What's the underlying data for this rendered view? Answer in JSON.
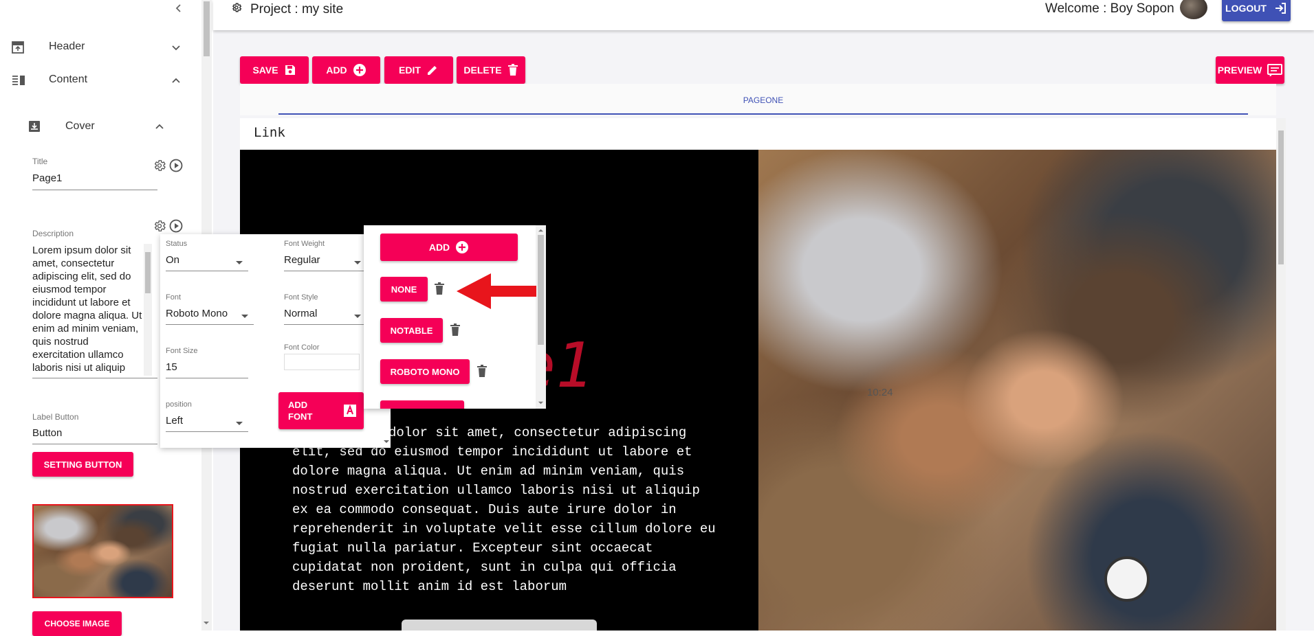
{
  "topbar": {
    "project_title": "Project : my site",
    "welcome": "Welcome : Boy Sopon",
    "logout_label": "LOGOUT"
  },
  "sidebar": {
    "items": [
      {
        "label": "Header",
        "icon": "header-icon"
      },
      {
        "label": "Content",
        "icon": "content-icon"
      }
    ],
    "cover": {
      "label": "Cover",
      "title_label": "Title",
      "title_value": "Page1",
      "description_label": "Description",
      "description_value": "Lorem ipsum dolor sit amet, consectetur adipiscing elit, sed do eiusmod tempor incididunt ut labore et dolore magna aliqua. Ut enim ad minim veniam, quis nostrud exercitation ullamco laboris nisi ut aliquip",
      "label_button_label": "Label Button",
      "label_button_value": "Button",
      "setting_button": "SETTING BUTTON",
      "choose_image": "CHOOSE IMAGE"
    }
  },
  "toolbar": {
    "save": "SAVE",
    "add": "ADD",
    "edit": "EDIT",
    "delete": "DELETE",
    "preview": "PREVIEW"
  },
  "tabs": {
    "active": "PAGEONE"
  },
  "preview": {
    "nav_link": "Link",
    "title_partial": "e1",
    "body": "dolor sit amet, consectetur adipiscing elit, sed do eiusmod tempor incididunt ut labore et dolore magna aliqua. Ut enim ad minim veniam, quis nostrud exercitation ullamco laboris nisi ut aliquip ex ea commodo consequat. Duis aute irure dolor in reprehenderit in voluptate velit esse cillum dolore eu fugiat nulla pariatur. Excepteur sint occaecat cupidatat non proident, sunt in culpa qui officia deserunt mollit anim id est laborum",
    "photo_clock": "10:24"
  },
  "font_panel": {
    "status_label": "Status",
    "status_value": "On",
    "font_weight_label": "Font Weight",
    "font_weight_value": "Regular",
    "font_label": "Font",
    "font_value": "Roboto Mono",
    "font_style_label": "Font Style",
    "font_style_value": "Normal",
    "font_size_label": "Font Size",
    "font_size_value": "15",
    "font_color_label": "Font Color",
    "position_label": "position",
    "position_value": "Left",
    "add_font": "ADD FONT"
  },
  "font_list": {
    "add": "ADD",
    "fonts": [
      "NONE",
      "NOTABLE",
      "ROBOTO MONO"
    ]
  },
  "colors": {
    "accent": "#f50057",
    "primary": "#3f51b5",
    "annotation_arrow": "#e8151c"
  }
}
